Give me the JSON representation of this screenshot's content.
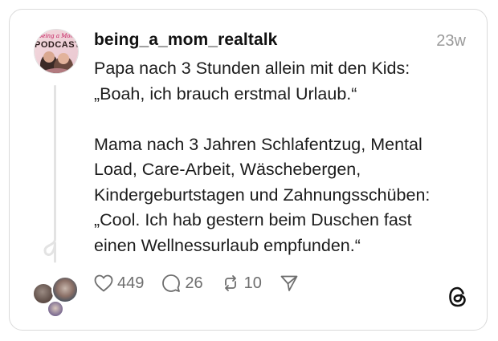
{
  "post": {
    "username": "being_a_mom_realtalk",
    "timestamp": "23w",
    "avatar_text": "PODCAST",
    "avatar_script": "being a Mom",
    "lines_block1": [
      "Papa nach 3 Stunden allein mit den Kids:",
      "„Boah, ich brauch erstmal Urlaub.“"
    ],
    "lines_block2": [
      "Mama nach 3 Jahren Schlafentzug, Mental",
      "Load, Care-Arbeit, Wäschebergen,",
      "Kindergeburtstagen und Zahnungsschüben:",
      "„Cool. Ich hab gestern beim Duschen fast",
      "einen Wellnessurlaub empfunden.“"
    ]
  },
  "actions": {
    "likes": "449",
    "comments": "26",
    "reposts": "10"
  },
  "icons": {
    "like": "heart-icon",
    "comment": "comment-bubble-icon",
    "repost": "repost-icon",
    "share": "send-icon",
    "brand": "threads-logo-icon"
  },
  "colors": {
    "text": "#1c1c1c",
    "muted": "#9a9a9a",
    "border": "#dadada"
  }
}
